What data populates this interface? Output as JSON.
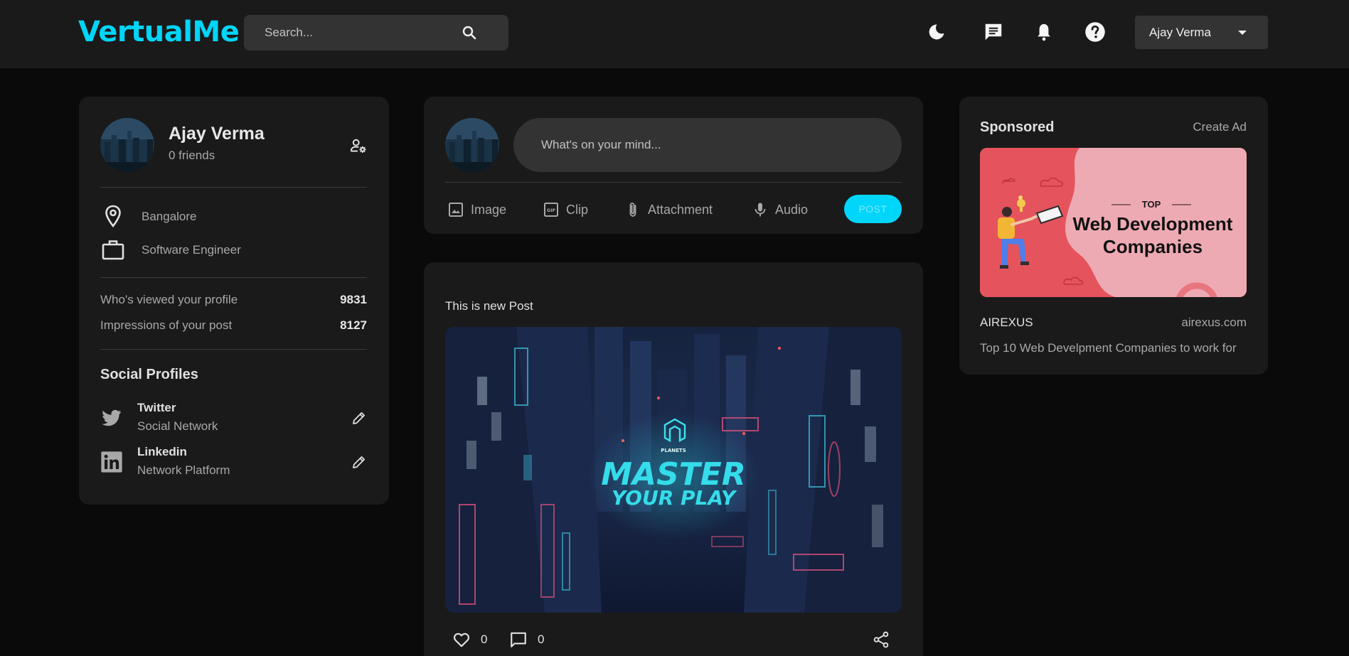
{
  "app": {
    "logo": "VertualMe"
  },
  "search": {
    "placeholder": "Search..."
  },
  "header": {
    "icons": [
      "moon-icon",
      "chat-icon",
      "bell-icon",
      "help-icon"
    ],
    "user_name": "Ajay Verma"
  },
  "profile": {
    "name": "Ajay Verma",
    "friends": "0 friends",
    "location": "Bangalore",
    "occupation": "Software Engineer",
    "stats": [
      {
        "label": "Who's viewed your profile",
        "value": "9831"
      },
      {
        "label": "Impressions of your post",
        "value": "8127"
      }
    ],
    "social_title": "Social Profiles",
    "socials": [
      {
        "name": "Twitter",
        "subtitle": "Social Network",
        "icon": "twitter-icon"
      },
      {
        "name": "Linkedin",
        "subtitle": "Network Platform",
        "icon": "linkedin-icon"
      }
    ]
  },
  "composer": {
    "placeholder": "What's on your mind...",
    "actions": [
      {
        "label": "Image",
        "icon": "image-icon"
      },
      {
        "label": "Clip",
        "icon": "gif-icon"
      },
      {
        "label": "Attachment",
        "icon": "paperclip-icon"
      },
      {
        "label": "Audio",
        "icon": "microphone-icon"
      }
    ],
    "post_label": "POST"
  },
  "post": {
    "text": "This is new Post",
    "image_text": {
      "brand": "PLANETS",
      "line1": "MASTER",
      "line2": "YOUR PLAY"
    },
    "likes": "0",
    "comments": "0"
  },
  "sponsored": {
    "title": "Sponsored",
    "create_ad": "Create Ad",
    "ad_image_text": {
      "top": "TOP",
      "line1": "Web Development",
      "line2": "Companies"
    },
    "company": "AIREXUS",
    "url": "airexus.com",
    "description": "Top 10 Web Develpment Companies to work for"
  },
  "colors": {
    "accent": "#00d5fa",
    "background": "#0a0a0a",
    "card": "#1a1a1a",
    "input": "#333333",
    "muted_text": "#a8a8a8"
  }
}
